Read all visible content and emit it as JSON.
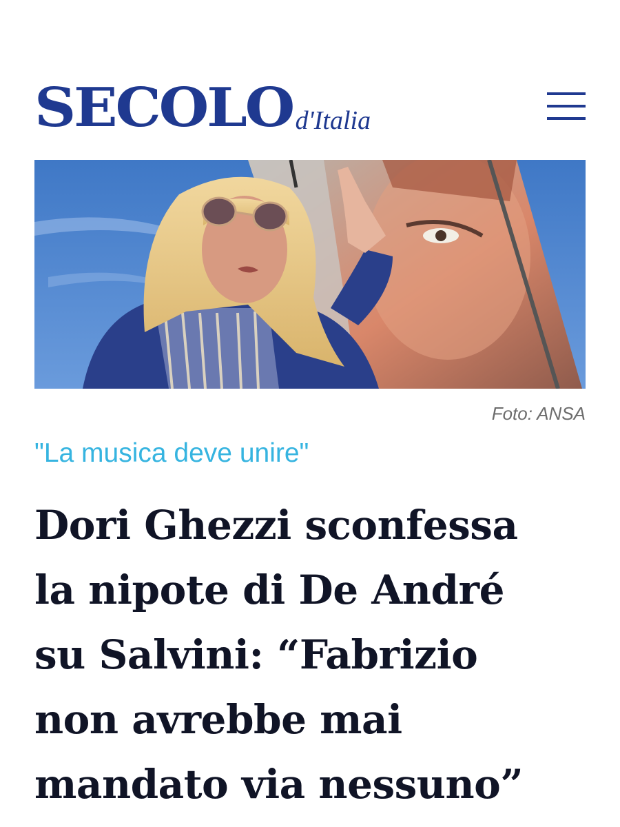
{
  "header": {
    "logo_main": "SECOLO",
    "logo_sub": "d'Italia",
    "menu_icon": "hamburger-menu-icon"
  },
  "hero": {
    "image_description_icon": "photo",
    "credit": "Foto: ANSA"
  },
  "article": {
    "kicker": "\"La musica deve unire\"",
    "headline_lines": [
      "Dori Ghezzi sconfessa",
      "la nipote di De André",
      "su Salvini: “Fabrizio",
      "non avrebbe mai",
      "mandato via nessuno”"
    ]
  },
  "colors": {
    "brand": "#1f3990",
    "kicker": "#36b4e0",
    "headline": "#101426",
    "credit": "#6c6c6c"
  }
}
